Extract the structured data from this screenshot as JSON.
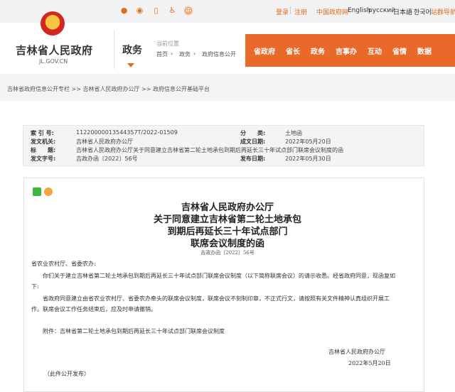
{
  "topbar": {
    "login": "登录",
    "register": "注册",
    "langs": [
      "中国政府网",
      "English",
      "русский",
      "日本語",
      "한국어",
      "站群导航"
    ]
  },
  "header": {
    "gov_name": "吉林省人民政府",
    "domain": "JL.GOV.CN",
    "section": "政务",
    "location_label": "当前位置",
    "location_path": [
      "首页",
      "政务",
      "政府信息公开"
    ],
    "nav": [
      "省政府",
      "省长",
      "政务",
      "吉事办",
      "互动",
      "省情",
      "数据"
    ]
  },
  "breadcrumb": "吉林省政府信息公开专栏 >> 吉林省人民政府办公厅 >> 政府信息公开基础平台",
  "meta": {
    "index_label": "索 引 号:",
    "index_value": "11220000013544357T/2022-01509",
    "category_label": "分　　类:",
    "category_value": "土地函",
    "issuer_label": "发文机关:",
    "issuer_value": "吉林省人民政府办公厅",
    "date_label": "成文日期:",
    "date_value": "2022年05月20日",
    "title_label": "标　　题:",
    "title_value": "吉林省人民政府办公厅关于同意建立吉林省第二轮土地承包到期后再延长三十年试点部门联席会议制度的函",
    "docno_label": "发文字号:",
    "docno_value": "吉政办函〔2022〕56号",
    "pub_label": "发布日期:",
    "pub_value": "2022年05月30日"
  },
  "document": {
    "title_lines": [
      "吉林省人民政府办公厅",
      "关于同意建立吉林省第二轮土地承包",
      "到期后再延长三十年试点部门",
      "联席会议制度的函"
    ],
    "doc_number": "吉政办函〔2022〕56号",
    "salutation": "省农业农村厅、省委农办:",
    "para1_line1": "你们关于建立吉林省第二轮土地承包到期后再延长三十年试点部门联席会议制度（以下简称联席会议）的请示收悉。经省政府同意，现函复如",
    "para1_line2": "下:",
    "para2_line1": "省政府同意建立由省农业农村厅、省委农办牵头的联席会议制度，联席会议不刻制印章，不正式行文，请按照有关文件精神认真组织开展工",
    "para2_line2": "作。联席会议工作任务结束后，应及时申请撤销。",
    "attachment": "附件：吉林省第二轮土地承包到期后再延长三十年试点部门联席会议制度",
    "signature": "吉林省人民政府办公厅",
    "sign_date": "2022年5月20日",
    "note": "（此件公开发布）"
  },
  "colors": {
    "accent": "#e8692a",
    "link": "#e06d1f"
  },
  "icons": [
    "weibo-icon",
    "wechat-icon",
    "mobile-icon",
    "accessibility-icon",
    "mascot-icon"
  ]
}
